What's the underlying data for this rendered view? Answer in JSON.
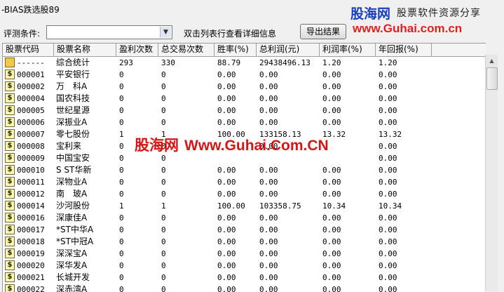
{
  "window": {
    "title": "-BIAS跌选股89"
  },
  "banner": {
    "logo_text": "股海网",
    "slogan": "股票软件资源分享",
    "url": "www.Guhai.com.cn"
  },
  "filter": {
    "label": "评测条件:",
    "select_value": "",
    "hint": "双击列表行查看详细信息",
    "export_label": "导出结果"
  },
  "table": {
    "columns": [
      "股票代码",
      "股票名称",
      "盈利次数",
      "总交易次数",
      "胜率(%)",
      "总利润(元)",
      "利润率(%)",
      "年回报(%)"
    ],
    "rows": [
      {
        "icon": "folder-icon",
        "code": "------",
        "name": "综合统计",
        "wins": "293",
        "trades": "330",
        "winrate": "88.79",
        "profit": "29438496.13",
        "profit_rate": "1.20",
        "annual": "1.20"
      },
      {
        "icon": "dollar-icon",
        "code": "000001",
        "name": "平安银行",
        "wins": "0",
        "trades": "0",
        "winrate": "0.00",
        "profit": "0.00",
        "profit_rate": "0.00",
        "annual": "0.00"
      },
      {
        "icon": "dollar-icon",
        "code": "000002",
        "name": "万　科A",
        "wins": "0",
        "trades": "0",
        "winrate": "0.00",
        "profit": "0.00",
        "profit_rate": "0.00",
        "annual": "0.00"
      },
      {
        "icon": "dollar-icon",
        "code": "000004",
        "name": "国农科技",
        "wins": "0",
        "trades": "0",
        "winrate": "0.00",
        "profit": "0.00",
        "profit_rate": "0.00",
        "annual": "0.00"
      },
      {
        "icon": "dollar-icon",
        "code": "000005",
        "name": "世纪星源",
        "wins": "0",
        "trades": "0",
        "winrate": "0.00",
        "profit": "0.00",
        "profit_rate": "0.00",
        "annual": "0.00"
      },
      {
        "icon": "dollar-icon",
        "code": "000006",
        "name": "深振业A",
        "wins": "0",
        "trades": "0",
        "winrate": "0.00",
        "profit": "0.00",
        "profit_rate": "0.00",
        "annual": "0.00"
      },
      {
        "icon": "dollar-icon",
        "code": "000007",
        "name": "零七股份",
        "wins": "1",
        "trades": "1",
        "winrate": "100.00",
        "profit": "133158.13",
        "profit_rate": "13.32",
        "annual": "13.32"
      },
      {
        "icon": "dollar-icon",
        "code": "000008",
        "name": "宝利来",
        "wins": "0",
        "trades": "0",
        "winrate": "",
        "profit": "0.00",
        "profit_rate": "",
        "annual": "0.00"
      },
      {
        "icon": "dollar-icon",
        "code": "000009",
        "name": "中国宝安",
        "wins": "0",
        "trades": "0",
        "winrate": "",
        "profit": "",
        "profit_rate": "",
        "annual": "0.00"
      },
      {
        "icon": "dollar-icon",
        "code": "000010",
        "name": "S ST华新",
        "wins": "0",
        "trades": "0",
        "winrate": "0.00",
        "profit": "0.00",
        "profit_rate": "0.00",
        "annual": "0.00"
      },
      {
        "icon": "dollar-icon",
        "code": "000011",
        "name": "深物业A",
        "wins": "0",
        "trades": "0",
        "winrate": "0.00",
        "profit": "0.00",
        "profit_rate": "0.00",
        "annual": "0.00"
      },
      {
        "icon": "dollar-icon",
        "code": "000012",
        "name": "南　玻A",
        "wins": "0",
        "trades": "0",
        "winrate": "0.00",
        "profit": "0.00",
        "profit_rate": "0.00",
        "annual": "0.00"
      },
      {
        "icon": "dollar-icon",
        "code": "000014",
        "name": "沙河股份",
        "wins": "1",
        "trades": "1",
        "winrate": "100.00",
        "profit": "103358.75",
        "profit_rate": "10.34",
        "annual": "10.34"
      },
      {
        "icon": "dollar-icon",
        "code": "000016",
        "name": "深康佳A",
        "wins": "0",
        "trades": "0",
        "winrate": "0.00",
        "profit": "0.00",
        "profit_rate": "0.00",
        "annual": "0.00"
      },
      {
        "icon": "dollar-icon",
        "code": "000017",
        "name": "*ST中华A",
        "wins": "0",
        "trades": "0",
        "winrate": "0.00",
        "profit": "0.00",
        "profit_rate": "0.00",
        "annual": "0.00"
      },
      {
        "icon": "dollar-icon",
        "code": "000018",
        "name": "*ST中冠A",
        "wins": "0",
        "trades": "0",
        "winrate": "0.00",
        "profit": "0.00",
        "profit_rate": "0.00",
        "annual": "0.00"
      },
      {
        "icon": "dollar-icon",
        "code": "000019",
        "name": "深深宝A",
        "wins": "0",
        "trades": "0",
        "winrate": "0.00",
        "profit": "0.00",
        "profit_rate": "0.00",
        "annual": "0.00"
      },
      {
        "icon": "dollar-icon",
        "code": "000020",
        "name": "深华发A",
        "wins": "0",
        "trades": "0",
        "winrate": "0.00",
        "profit": "0.00",
        "profit_rate": "0.00",
        "annual": "0.00"
      },
      {
        "icon": "dollar-icon",
        "code": "000021",
        "name": "长城开发",
        "wins": "0",
        "trades": "0",
        "winrate": "0.00",
        "profit": "0.00",
        "profit_rate": "0.00",
        "annual": "0.00"
      },
      {
        "icon": "dollar-icon",
        "code": "000022",
        "name": "深赤湾A",
        "wins": "0",
        "trades": "0",
        "winrate": "0.00",
        "profit": "0.00",
        "profit_rate": "0.00",
        "annual": "0.00"
      }
    ]
  },
  "watermark": {
    "cn": "股海网",
    "en": "Www.Guhai.Com.CN"
  },
  "colors": {
    "accent_blue": "#1a3fbd",
    "accent_red": "#d51515",
    "icon_yellow": "#fff6b0"
  }
}
